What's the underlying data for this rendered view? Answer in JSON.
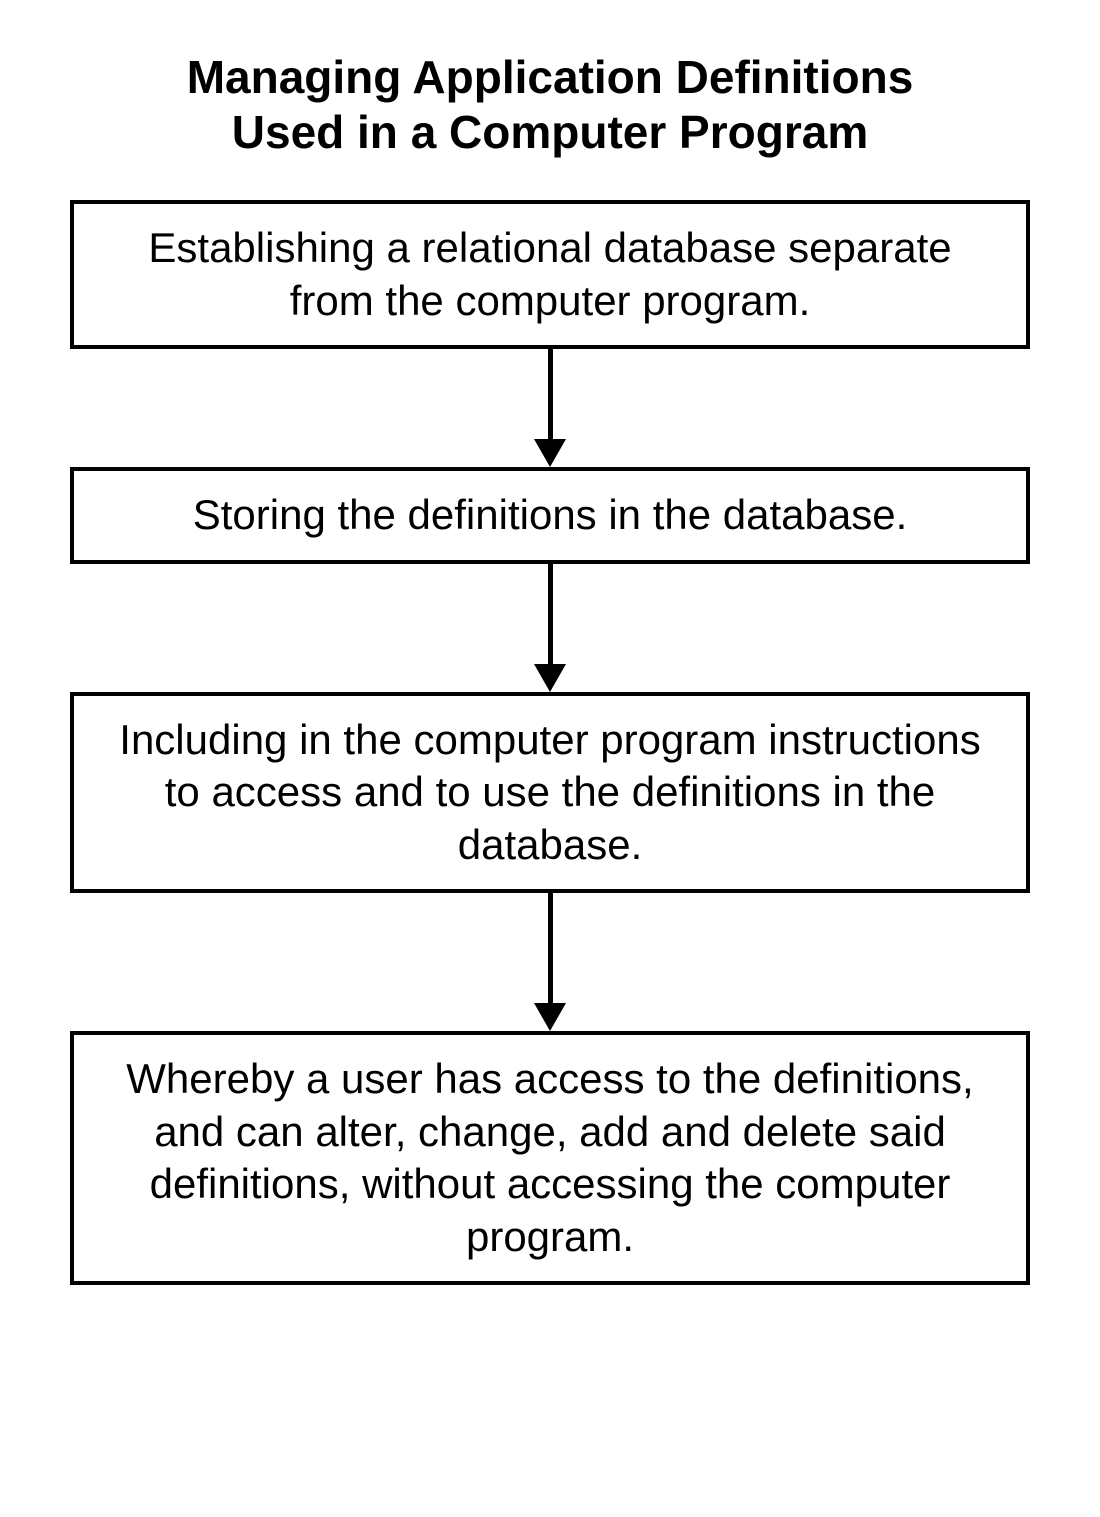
{
  "title_line1": "Managing Application Definitions",
  "title_line2": "Used in a Computer Program",
  "boxes": {
    "0": "Establishing a relational database separate from the computer program.",
    "1": "Storing the definitions in the database.",
    "2": "Including in the computer program instructions to access and to use the definitions in the database.",
    "3": "Whereby a user has access to the definitions, and can alter, change, add and delete said definitions, without accessing the computer program."
  },
  "arrow_heights": {
    "0": 90,
    "1": 100,
    "2": 110
  }
}
